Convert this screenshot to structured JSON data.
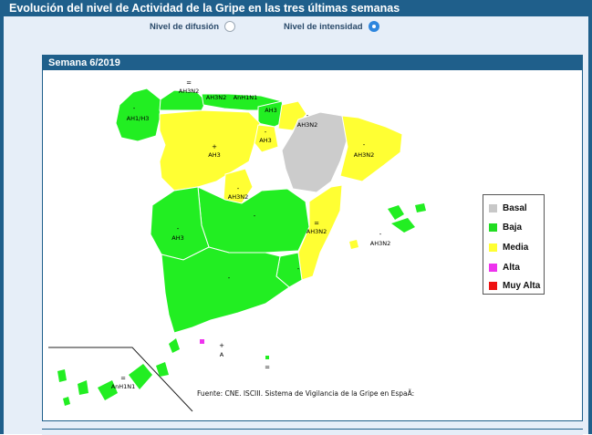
{
  "header": {
    "title": "Evolución del nivel de Actividad de la Gripe en las tres últimas semanas"
  },
  "toggles": [
    {
      "label": "Nivel de difusión",
      "selected": false
    },
    {
      "label": "Nivel de intensidad",
      "selected": true
    }
  ],
  "panel": {
    "title": "Semana 6/2019"
  },
  "map": {
    "labels": {
      "galicia": "AH1/H3",
      "asturias": "AH3N2",
      "cantabria": "AH3N2",
      "pais_vasco": "AnH1N1",
      "navarra": "AH3",
      "la_rioja": "AH3N2",
      "rioja_sub": "AH3",
      "cataluna": "AH3N2",
      "castilla_leon": "AH3",
      "madrid": "AH3N2",
      "extremadura": "AH3",
      "valencia": "AH3N2",
      "baleares": "AH3N2",
      "ceuta": "A",
      "canarias": "AnH1N1"
    },
    "trend_marks": {
      "plus": "+",
      "minus": "-",
      "equal": "="
    },
    "source": "Fuente: CNE. ISCIII. Sistema de Vigilancia de la Gripe en EspaÃ:"
  },
  "legend": [
    {
      "label": "Basal",
      "color": "#c8c8c8"
    },
    {
      "label": "Baja",
      "color": "#22dd22"
    },
    {
      "label": "Media",
      "color": "#ffff33"
    },
    {
      "label": "Alta",
      "color": "#ee33ee"
    },
    {
      "label": "Muy Alta",
      "color": "#ee1111"
    }
  ],
  "colors": {
    "baja": "#22ee22",
    "media": "#ffff33",
    "basal": "#cccccc",
    "alta": "#ee33ee",
    "frame": "#1f5f8b"
  }
}
